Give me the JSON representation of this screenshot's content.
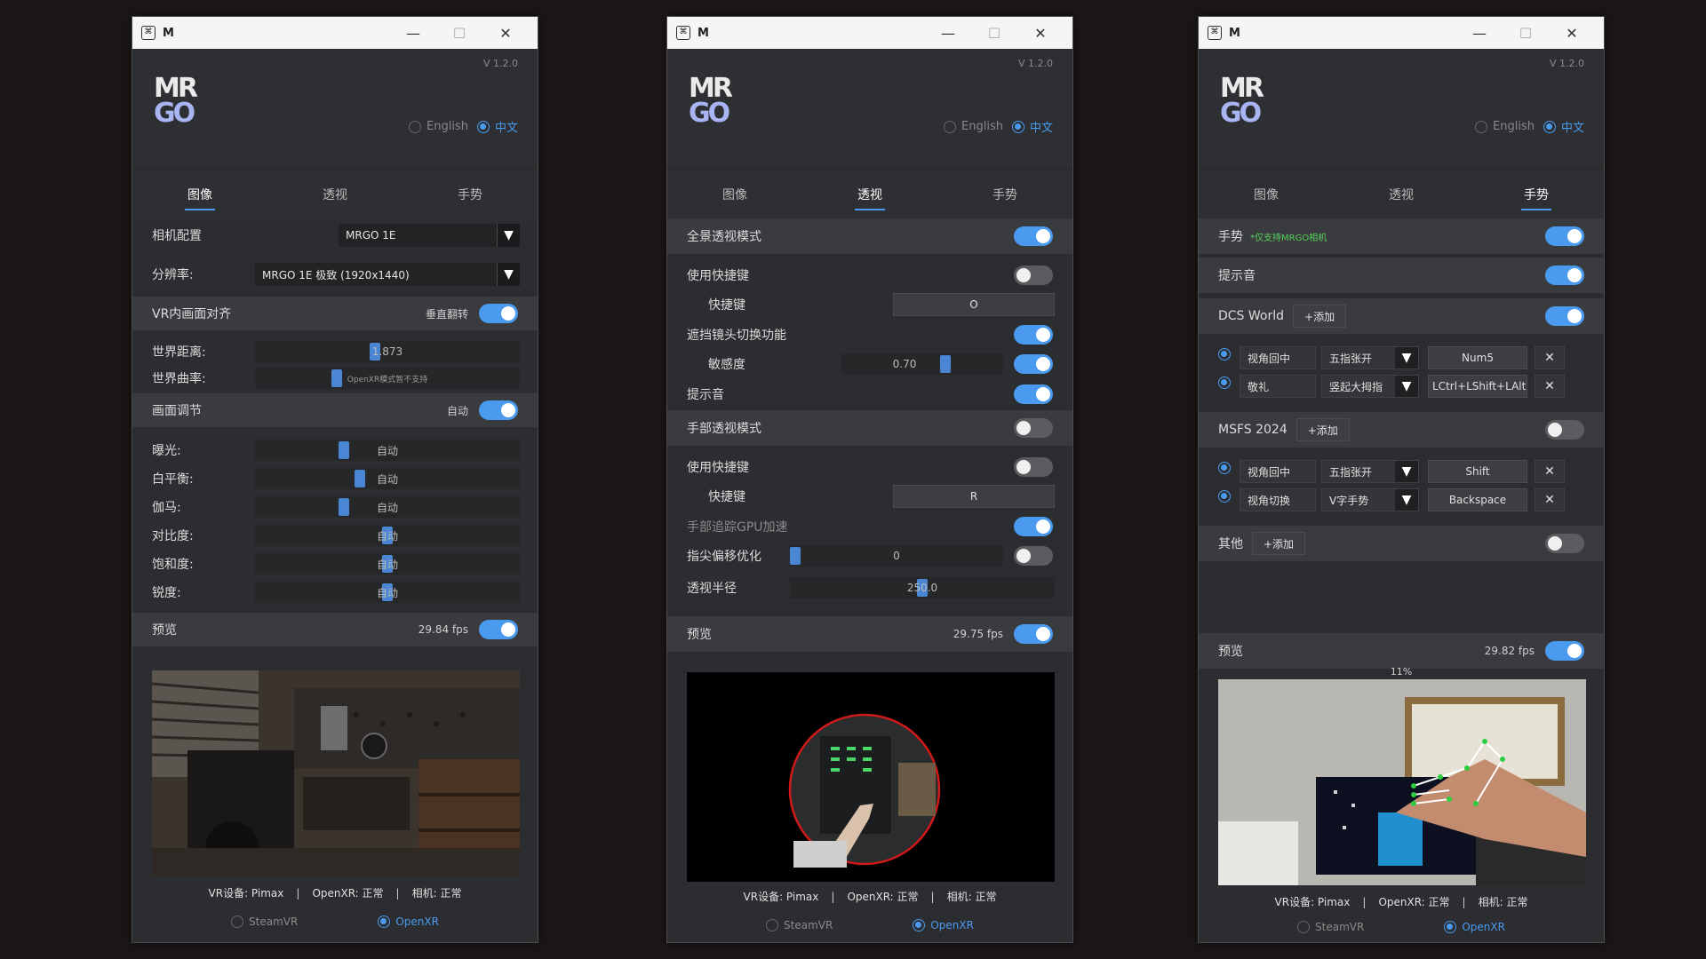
{
  "common": {
    "title": "M",
    "version": "V 1.2.0",
    "logo_top": "MR",
    "logo_bottom": "GO",
    "lang_en": "English",
    "lang_zh": "中文",
    "tabs": [
      "图像",
      "透视",
      "手势"
    ],
    "status": {
      "vr_device": "VR设备: Pimax",
      "openxr": "OpenXR: 正常",
      "camera": "相机: 正常",
      "sep": "|"
    },
    "runtime": {
      "steamvr": "SteamVR",
      "openxr": "OpenXR"
    },
    "preview_label": "预览",
    "minimize": "—",
    "maximize": "☐",
    "close": "✕",
    "arrow": "▼"
  },
  "w0": {
    "camera_config_label": "相机配置",
    "camera_config_value": "MRGO 1E",
    "resolution_label": "分辨率:",
    "resolution_value": "MRGO 1E 极致 (1920x1440)",
    "vr_align_label": "VR内画面对齐",
    "vertical_flip": "垂直翻转",
    "world_distance_label": "世界距离:",
    "world_distance_value": "1.873",
    "world_distance_level": 0.45,
    "world_curvature_label": "世界曲率:",
    "world_curvature_value": "OpenXR模式暂不支持",
    "world_curvature_level": 0.3,
    "image_adjust_label": "画面调节",
    "auto": "自动",
    "adjust_items": [
      {
        "label": "曝光:",
        "value": "自动",
        "level": 0.33
      },
      {
        "label": "白平衡:",
        "value": "自动",
        "level": 0.39
      },
      {
        "label": "伽马:",
        "value": "自动",
        "level": 0.33
      },
      {
        "label": "对比度:",
        "value": "自动",
        "level": 0.5
      },
      {
        "label": "饱和度:",
        "value": "自动",
        "level": 0.5
      },
      {
        "label": "锐度:",
        "value": "自动",
        "level": 0.5
      }
    ],
    "fps": "29.84 fps"
  },
  "w1": {
    "panorama_label": "全景透视模式",
    "use_hotkey_label": "使用快捷键",
    "hotkey_label": "快捷键",
    "hotkey1_value": "O",
    "occlusion_label": "遮挡镜头切换功能",
    "sensitivity_label": "敏感度",
    "sensitivity_value": "0.70",
    "sensitivity_level": 0.65,
    "prompt_sound_label": "提示音",
    "hand_mode_label": "手部透视模式",
    "hotkey2_value": "R",
    "gpu_label": "手部追踪GPU加速",
    "fingertip_label": "指尖偏移优化",
    "fingertip_value": "0",
    "fingertip_level": 0.0,
    "radius_label": "透视半径",
    "radius_value": "250.0",
    "radius_level": 0.5,
    "fps": "29.75 fps"
  },
  "w2": {
    "gesture_label": "手势",
    "gesture_note": "*仅支持MRGO相机",
    "prompt_sound_label": "提示音",
    "add_label": "+添加",
    "groups": [
      {
        "name": "DCS World",
        "enabled": true,
        "items": [
          {
            "action": "视角回中",
            "gesture": "五指张开",
            "key": "Num5"
          },
          {
            "action": "敬礼",
            "gesture": "竖起大拇指",
            "key": "LCtrl+LShift+LAlt+S"
          }
        ]
      },
      {
        "name": "MSFS 2024",
        "enabled": false,
        "items": [
          {
            "action": "视角回中",
            "gesture": "五指张开",
            "key": "Shift"
          },
          {
            "action": "视角切换",
            "gesture": "V字手势",
            "key": "Backspace"
          }
        ]
      }
    ],
    "other_label": "其他",
    "fps": "29.82 fps",
    "progress_label": "11%",
    "progress_value": 0.11
  },
  "colors": {
    "accent": "#4a9af0",
    "note": "#57d15a"
  }
}
